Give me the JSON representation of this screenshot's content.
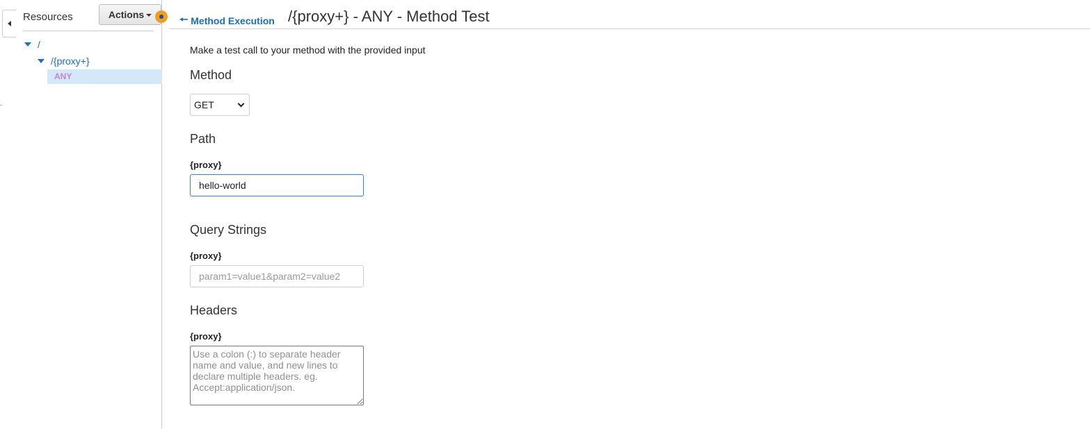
{
  "sidebar": {
    "title": "Resources",
    "actions_label": "Actions",
    "tree": [
      {
        "label": "/",
        "expanded": true
      },
      {
        "label": "/{proxy+}",
        "expanded": true
      },
      {
        "label": "ANY",
        "selected": true
      }
    ]
  },
  "header": {
    "back_label": "Method Execution",
    "title": "/{proxy+} - ANY - Method Test"
  },
  "main": {
    "intro": "Make a test call to your method with the provided input",
    "method": {
      "title": "Method",
      "selected": "GET"
    },
    "path": {
      "title": "Path",
      "label": "{proxy}",
      "value": "hello-world"
    },
    "query": {
      "title": "Query Strings",
      "label": "{proxy}",
      "value": "",
      "placeholder": "param1=value1&param2=value2"
    },
    "headers": {
      "title": "Headers",
      "label": "{proxy}",
      "value": "",
      "placeholder": "Use a colon (:) to separate header name and value, and new lines to declare multiple headers. eg. Accept:application/json."
    }
  },
  "colors": {
    "link": "#1a6cc4",
    "selected_bg": "#d5e8f9",
    "method_badge": "#c583d3",
    "status_dot": "#f29d1e",
    "focus_border": "#3b83d0"
  }
}
